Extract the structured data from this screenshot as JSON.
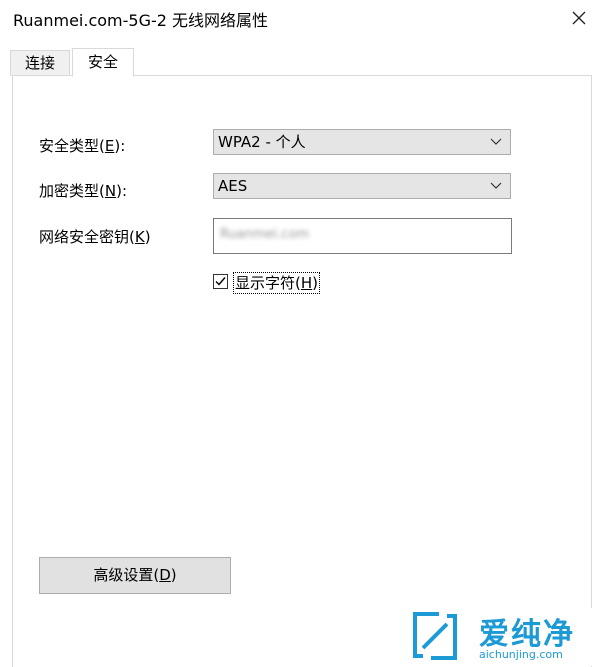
{
  "window": {
    "title": "Ruanmei.com-5G-2 无线网络属性",
    "close_icon": "close-icon"
  },
  "tabs": [
    {
      "label": "连接",
      "selected": false
    },
    {
      "label": "安全",
      "selected": true
    }
  ],
  "security": {
    "security_type": {
      "label": "安全类型",
      "accel": "E",
      "value": "WPA2 - 个人"
    },
    "encryption_type": {
      "label": "加密类型",
      "accel": "N",
      "value": "AES"
    },
    "network_key": {
      "label": "网络安全密钥",
      "accel": "K",
      "value": "Ruanmei.com"
    },
    "show_chars": {
      "label": "显示字符",
      "accel": "H",
      "checked": true
    }
  },
  "advanced_button": {
    "label": "高级设置",
    "accel": "D"
  },
  "watermark": {
    "name": "爱纯净",
    "url": "aichunjing.com",
    "color": "#1c9ad6"
  }
}
